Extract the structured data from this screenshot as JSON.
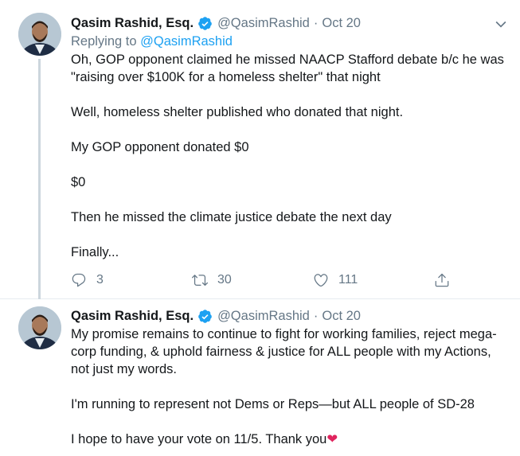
{
  "tweets": [
    {
      "author_name": "Qasim Rashid, Esq.",
      "handle": "@QasimRashid",
      "separator": "·",
      "date": "Oct 20",
      "replying_prefix": "Replying to",
      "replying_to": "@QasimRashid",
      "paragraphs": [
        "Oh, GOP opponent claimed he missed NAACP Stafford debate b/c he was \"raising over $100K for a homeless shelter\" that night",
        "Well, homeless shelter published who donated that night.",
        "My GOP opponent donated $0",
        "$0",
        "Then he missed the climate justice debate the next day",
        "Finally..."
      ],
      "replies": "3",
      "retweets": "30",
      "likes": "111"
    },
    {
      "author_name": "Qasim Rashid, Esq.",
      "handle": "@QasimRashid",
      "separator": "·",
      "date": "Oct 20",
      "paragraphs": [
        "My promise remains to continue to fight for working families, reject mega-corp funding, & uphold fairness & justice for ALL people with my Actions, not just my words.",
        "I'm running to represent not Dems or Reps—but ALL people of SD-28"
      ],
      "last_line_text": "I hope to have your vote on 11/5. Thank you",
      "last_line_emoji": "❤"
    }
  ],
  "icons": {
    "verified": "verified-badge-icon",
    "reply": "reply-icon",
    "retweet": "retweet-icon",
    "like": "heart-icon",
    "share": "share-icon",
    "more": "chevron-down-icon"
  },
  "colors": {
    "link": "#1da1f2",
    "secondary_text": "#657786",
    "thread_line": "#ccd6dd",
    "verified": "#1da1f2",
    "heart_emoji": "#e0245e"
  }
}
